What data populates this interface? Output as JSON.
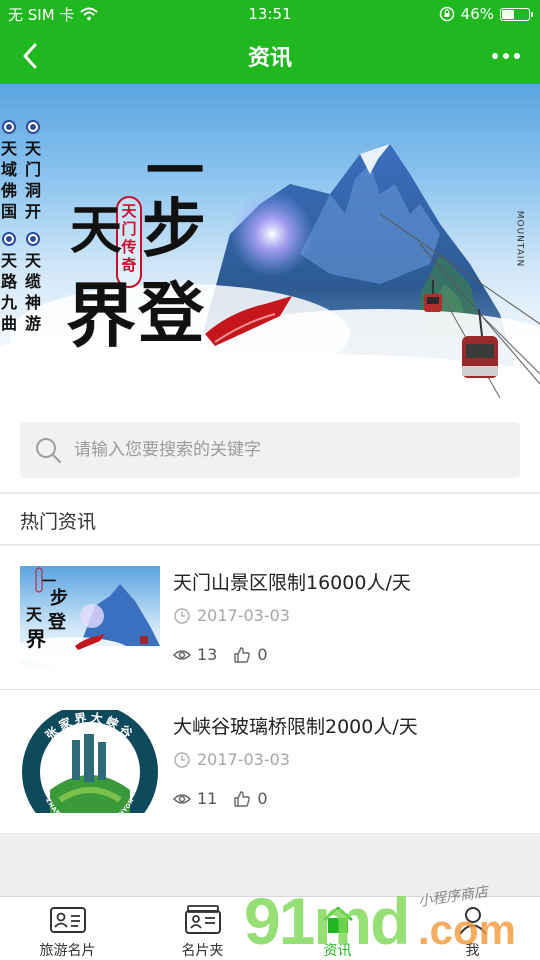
{
  "status_bar": {
    "carrier": "无 SIM 卡",
    "time": "13:51",
    "battery_percent": "46%",
    "battery_level": 0.46
  },
  "header": {
    "title": "资讯"
  },
  "banner": {
    "columns": [
      "天域佛国",
      "天门洞开",
      "天路九曲",
      "天缆神游"
    ],
    "seal_text": "天门传奇",
    "calligraphy": [
      "一",
      "步",
      "登",
      "天",
      "界"
    ],
    "side_caption": "MOUNTAIN",
    "slide_count": 2,
    "active_slide": 2
  },
  "search": {
    "placeholder": "请输入您要搜索的关键字"
  },
  "hot_news": {
    "heading": "热门资讯",
    "items": [
      {
        "title": "天门山景区限制16000人/天",
        "date": "2017-03-03",
        "views": "13",
        "likes": "0"
      },
      {
        "title": "大峡谷玻璃桥限制2000人/天",
        "date": "2017-03-03",
        "views": "11",
        "likes": "0"
      }
    ]
  },
  "thumb2": {
    "ring_top": "张家界大峡谷",
    "ring_bottom": "ZHANGJIAJIE GRAND CANYON"
  },
  "tabbar": {
    "tabs": [
      {
        "label": "旅游名片",
        "icon": "id-card-icon"
      },
      {
        "label": "名片夹",
        "icon": "card-holder-icon"
      },
      {
        "label": "资讯",
        "icon": "home-icon"
      },
      {
        "label": "我",
        "icon": "user-icon"
      }
    ],
    "active_tab": "资讯"
  },
  "watermark": {
    "brand": "91md",
    "suffix": ".com",
    "shop": "小程序商店"
  },
  "colors": {
    "brand_green": "#1fb81f",
    "text_gray": "#a6a6a6",
    "seal_red": "#c8102e"
  }
}
